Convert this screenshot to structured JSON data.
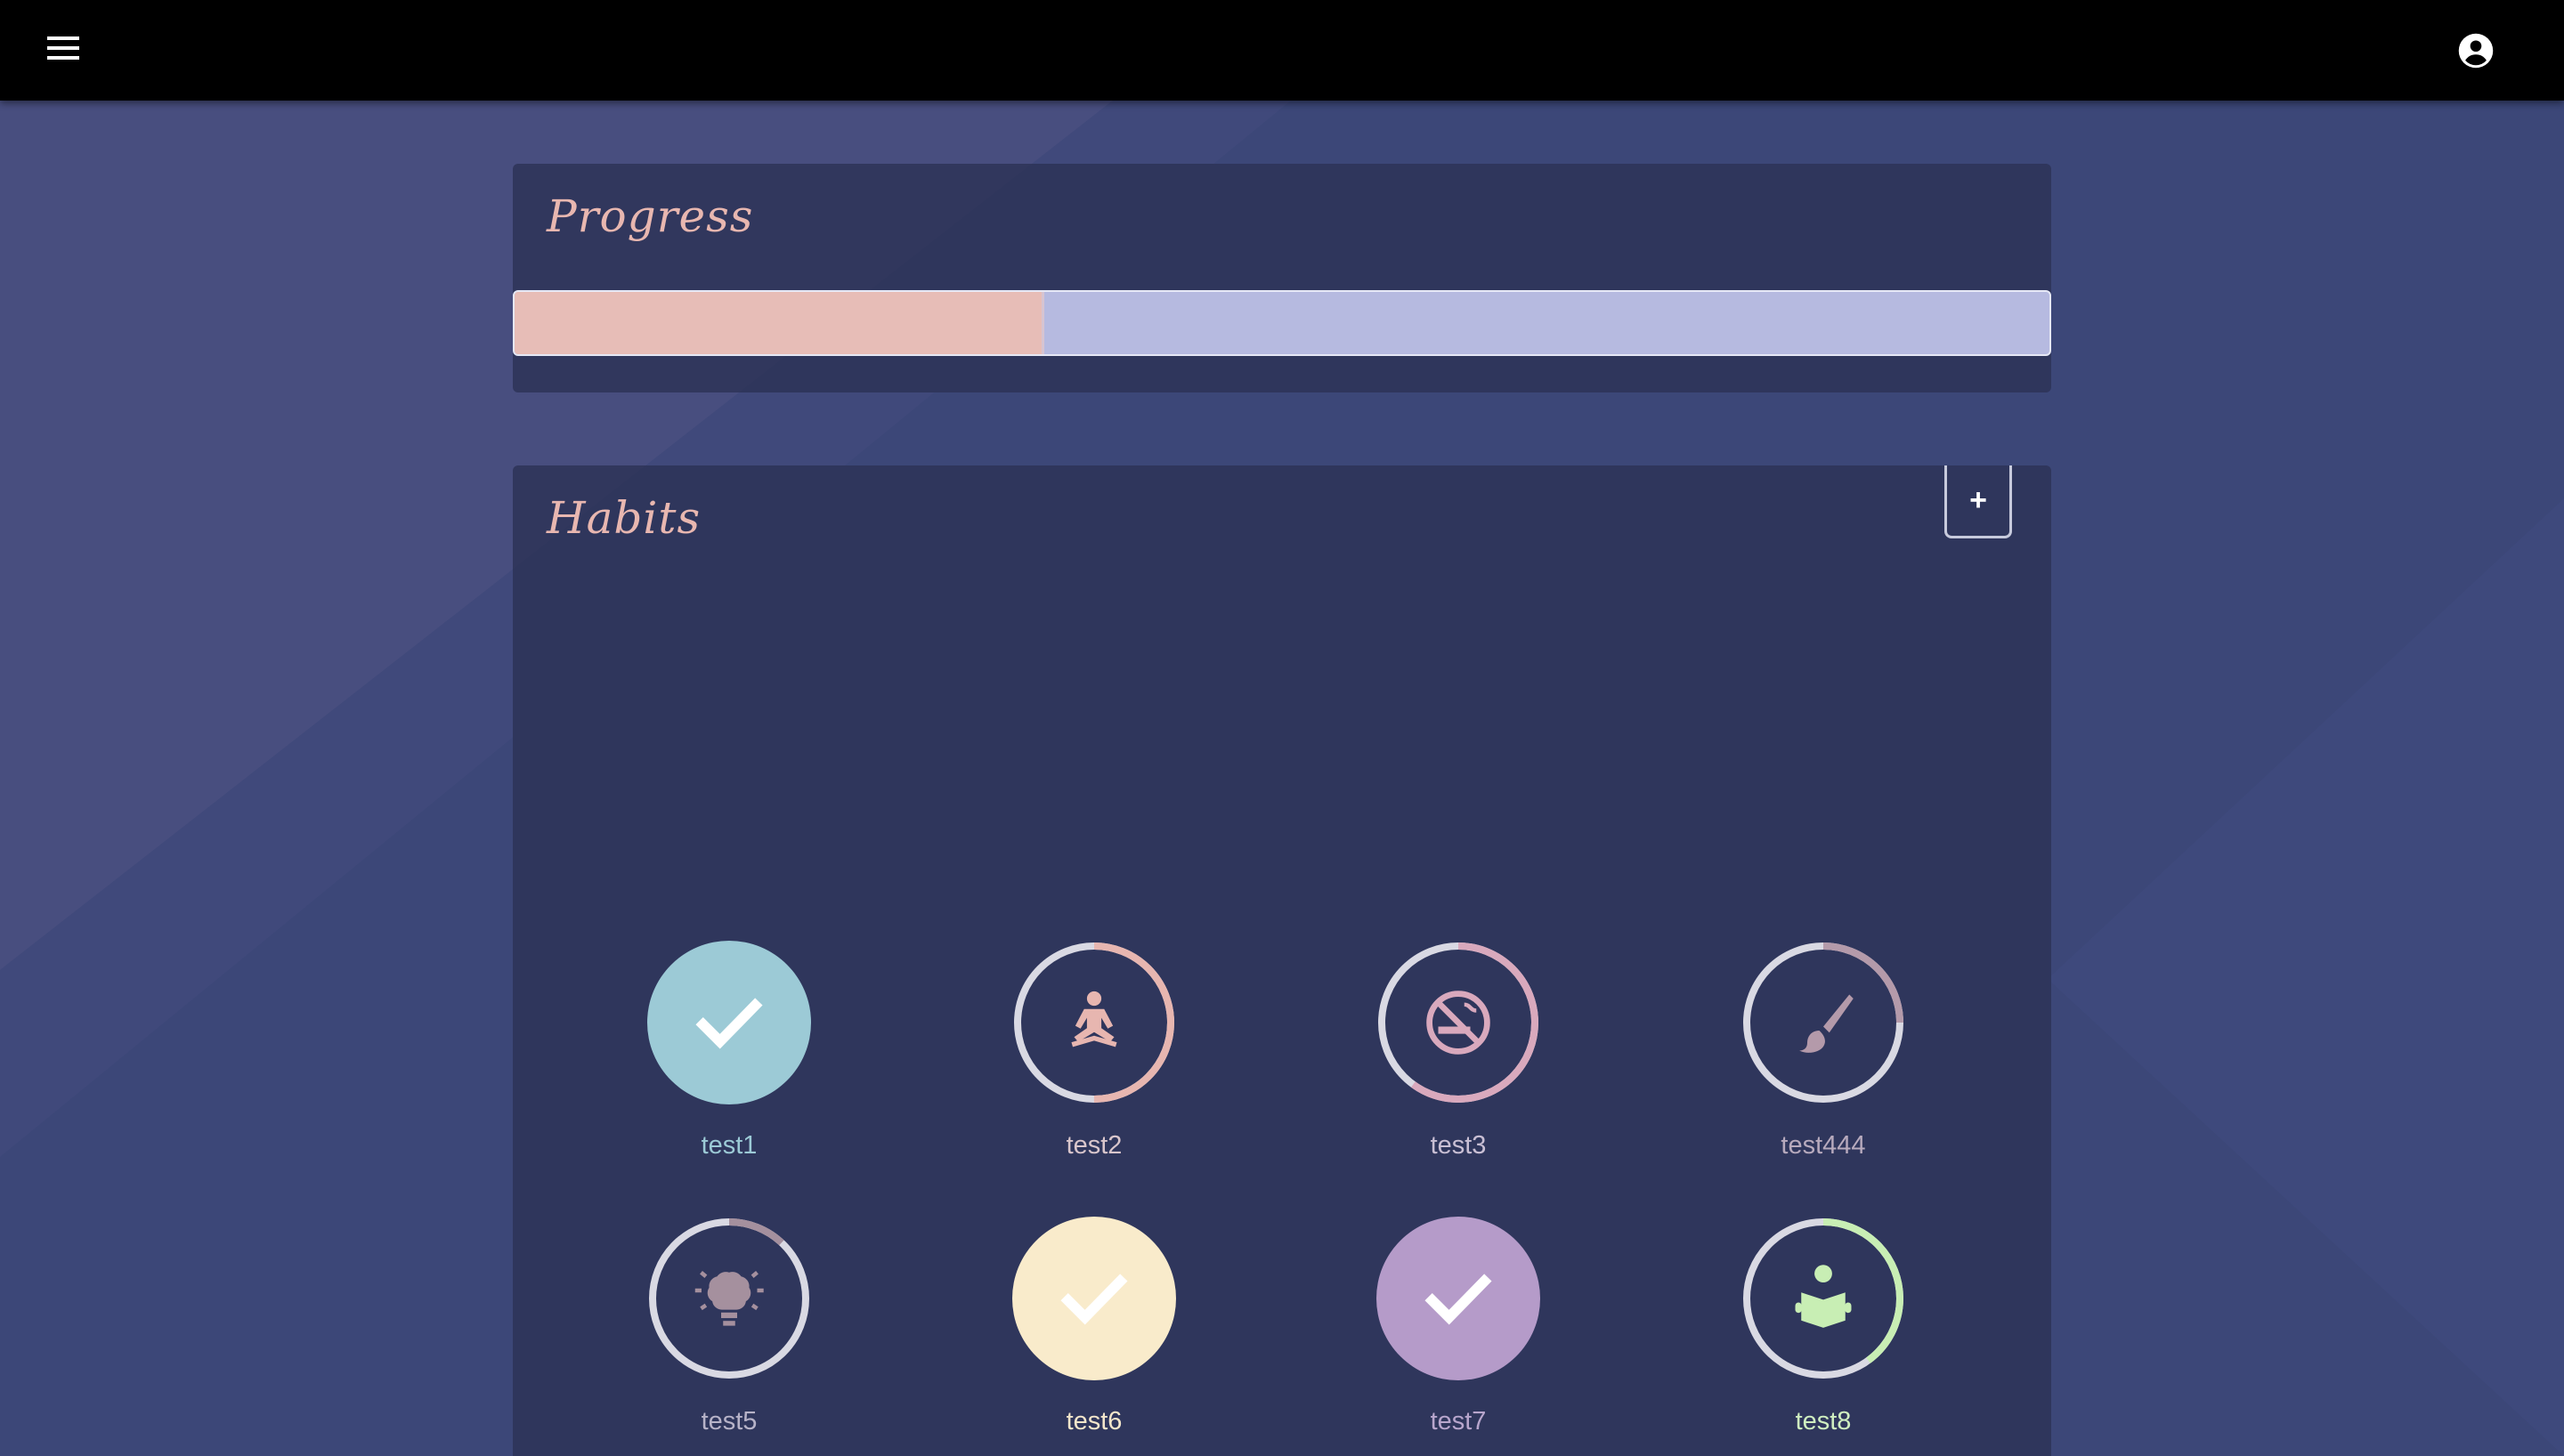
{
  "app": {
    "menu_icon": "menu-icon",
    "account_icon": "account-circle-icon"
  },
  "progress": {
    "title": "Progress",
    "value_fraction": 0.345,
    "fill_color": "#e7bdb7",
    "track_color": "#b6bae0"
  },
  "habits": {
    "title": "Habits",
    "add_label": "+",
    "items": [
      {
        "label": "test1",
        "icon": "check-icon",
        "completed": true,
        "color": "#9ccad6",
        "label_color": "#9ccad6"
      },
      {
        "label": "test2",
        "icon": "meditation-icon",
        "completed": false,
        "color": "#e7b6b0",
        "ring_progress": 0.5,
        "label_color": "#d9c6cc"
      },
      {
        "label": "test3",
        "icon": "no-smoking-icon",
        "completed": false,
        "color": "#d9a9bd",
        "ring_progress": 0.6,
        "label_color": "#c9bfd4"
      },
      {
        "label": "test444",
        "icon": "paintbrush-icon",
        "completed": false,
        "color": "#b49aaa",
        "ring_progress": 0.25,
        "label_color": "#b7aabd"
      },
      {
        "label": "test5",
        "icon": "brain-idea-icon",
        "completed": false,
        "color": "#a5909e",
        "ring_progress": 0.12,
        "label_color": "#b7b3c8"
      },
      {
        "label": "test6",
        "icon": "check-icon",
        "completed": true,
        "color": "#f9ebcb",
        "label_color": "#f3e6cb"
      },
      {
        "label": "test7",
        "icon": "check-icon",
        "completed": true,
        "color": "#b59bc9",
        "label_color": "#b8a6cd"
      },
      {
        "label": "test8",
        "icon": "reading-icon",
        "completed": false,
        "color": "#c8eeb4",
        "ring_progress": 0.4,
        "label_color": "#cfeec0"
      }
    ]
  }
}
